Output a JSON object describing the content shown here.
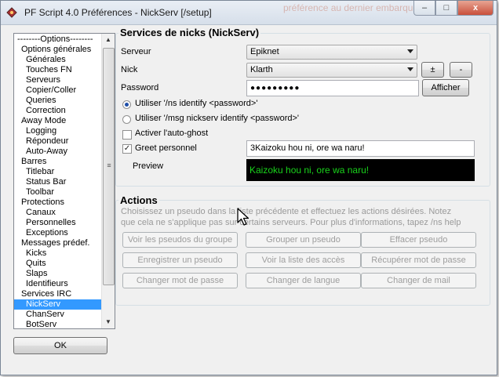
{
  "window": {
    "title": "PF Script 4.0 Préférences - NickServ [/setup]",
    "background_title_text": "préférence au dernier embarquement d'après",
    "minimize_label": "–",
    "maximize_label": "□",
    "close_label": "x"
  },
  "tree": {
    "items": [
      {
        "label": "--------Options--------",
        "indent": 0
      },
      {
        "label": "Options générales",
        "indent": 1
      },
      {
        "label": "Générales",
        "indent": 2
      },
      {
        "label": "Touches FN",
        "indent": 2
      },
      {
        "label": "Serveurs",
        "indent": 2
      },
      {
        "label": "Copier/Coller",
        "indent": 2
      },
      {
        "label": "Queries",
        "indent": 2
      },
      {
        "label": "Correction",
        "indent": 2
      },
      {
        "label": "Away Mode",
        "indent": 1
      },
      {
        "label": "Logging",
        "indent": 2
      },
      {
        "label": "Répondeur",
        "indent": 2
      },
      {
        "label": "Auto-Away",
        "indent": 2
      },
      {
        "label": "Barres",
        "indent": 1
      },
      {
        "label": "Titlebar",
        "indent": 2
      },
      {
        "label": "Status Bar",
        "indent": 2
      },
      {
        "label": "Toolbar",
        "indent": 2
      },
      {
        "label": "Protections",
        "indent": 1
      },
      {
        "label": "Canaux",
        "indent": 2
      },
      {
        "label": "Personnelles",
        "indent": 2
      },
      {
        "label": "Exceptions",
        "indent": 2
      },
      {
        "label": "Messages prédef.",
        "indent": 1
      },
      {
        "label": "Kicks",
        "indent": 2
      },
      {
        "label": "Quits",
        "indent": 2
      },
      {
        "label": "Slaps",
        "indent": 2
      },
      {
        "label": "Identifieurs",
        "indent": 2
      },
      {
        "label": "Services IRC",
        "indent": 1
      },
      {
        "label": "NickServ",
        "indent": 2,
        "selected": true
      },
      {
        "label": "ChanServ",
        "indent": 2
      },
      {
        "label": "BotServ",
        "indent": 2
      }
    ],
    "scroll_up": "▲",
    "scroll_down": "▼",
    "grip": "≡"
  },
  "ok_label": "OK",
  "nickserv": {
    "group_title": "Services de nicks (NickServ)",
    "server_label": "Serveur",
    "server_value": "Epiknet",
    "nick_label": "Nick",
    "nick_value": "Klarth",
    "plus_minus_label": "±",
    "minus_label": "-",
    "password_label": "Password",
    "password_value": "●●●●●●●●●",
    "show_label": "Afficher",
    "radio1_label": "Utiliser '/ns identify <password>'",
    "radio2_label": "Utiliser '/msg nickserv identify <password>'",
    "autoghost_label": "Activer l'auto-ghost",
    "autoghost_checked": false,
    "greet_label": "Greet personnel",
    "greet_checked": true,
    "greet_check_mark": "✓",
    "greet_value": "\u00033Kaizoku hou ni, ore wa naru!",
    "preview_label": "Preview",
    "preview_text": "Kaizoku hou ni, ore wa naru!"
  },
  "actions": {
    "group_title": "Actions",
    "help_text": "Choisissez un pseudo dans la liste précédente et effectuez les actions désirées. Notez que cela ne s'applique pas sur certains serveurs. Pour plus d'informations, tapez /ns help",
    "buttons": [
      "Voir les pseudos du groupe",
      "Grouper un pseudo",
      "Effacer pseudo",
      "Enregistrer un pseudo",
      "Voir la liste des accès",
      "Récupérer mot de passe",
      "Changer mot de passe",
      "Changer de langue",
      "Changer de mail"
    ]
  },
  "colors": {
    "selection": "#3399ff",
    "preview_bg": "#000000",
    "preview_fg": "#19d31b"
  }
}
